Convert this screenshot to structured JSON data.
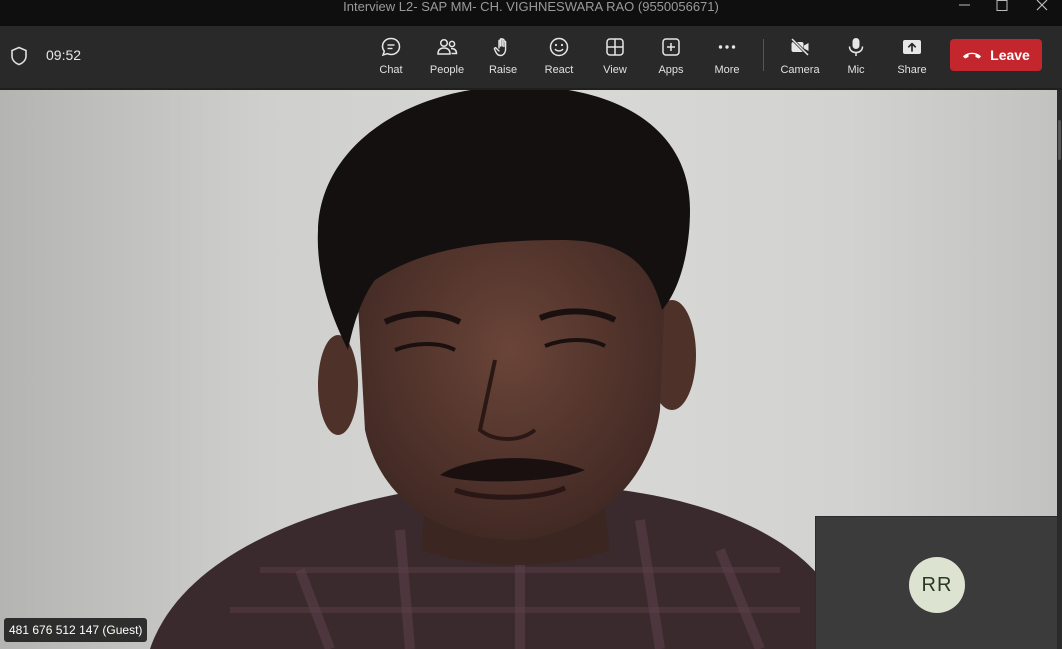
{
  "window": {
    "title": "Interview L2- SAP MM- CH. VIGHNESWARA RAO (9550056671)"
  },
  "toolbar": {
    "timer": "09:52",
    "buttons": {
      "chat": "Chat",
      "people": "People",
      "raise": "Raise",
      "react": "React",
      "view": "View",
      "apps": "Apps",
      "more": "More",
      "camera": "Camera",
      "mic": "Mic",
      "share": "Share"
    },
    "leave_label": "Leave",
    "leave_color": "#c4262e"
  },
  "stage": {
    "guest_label": "481 676 512 147 (Guest)",
    "self_initials": "RR"
  }
}
